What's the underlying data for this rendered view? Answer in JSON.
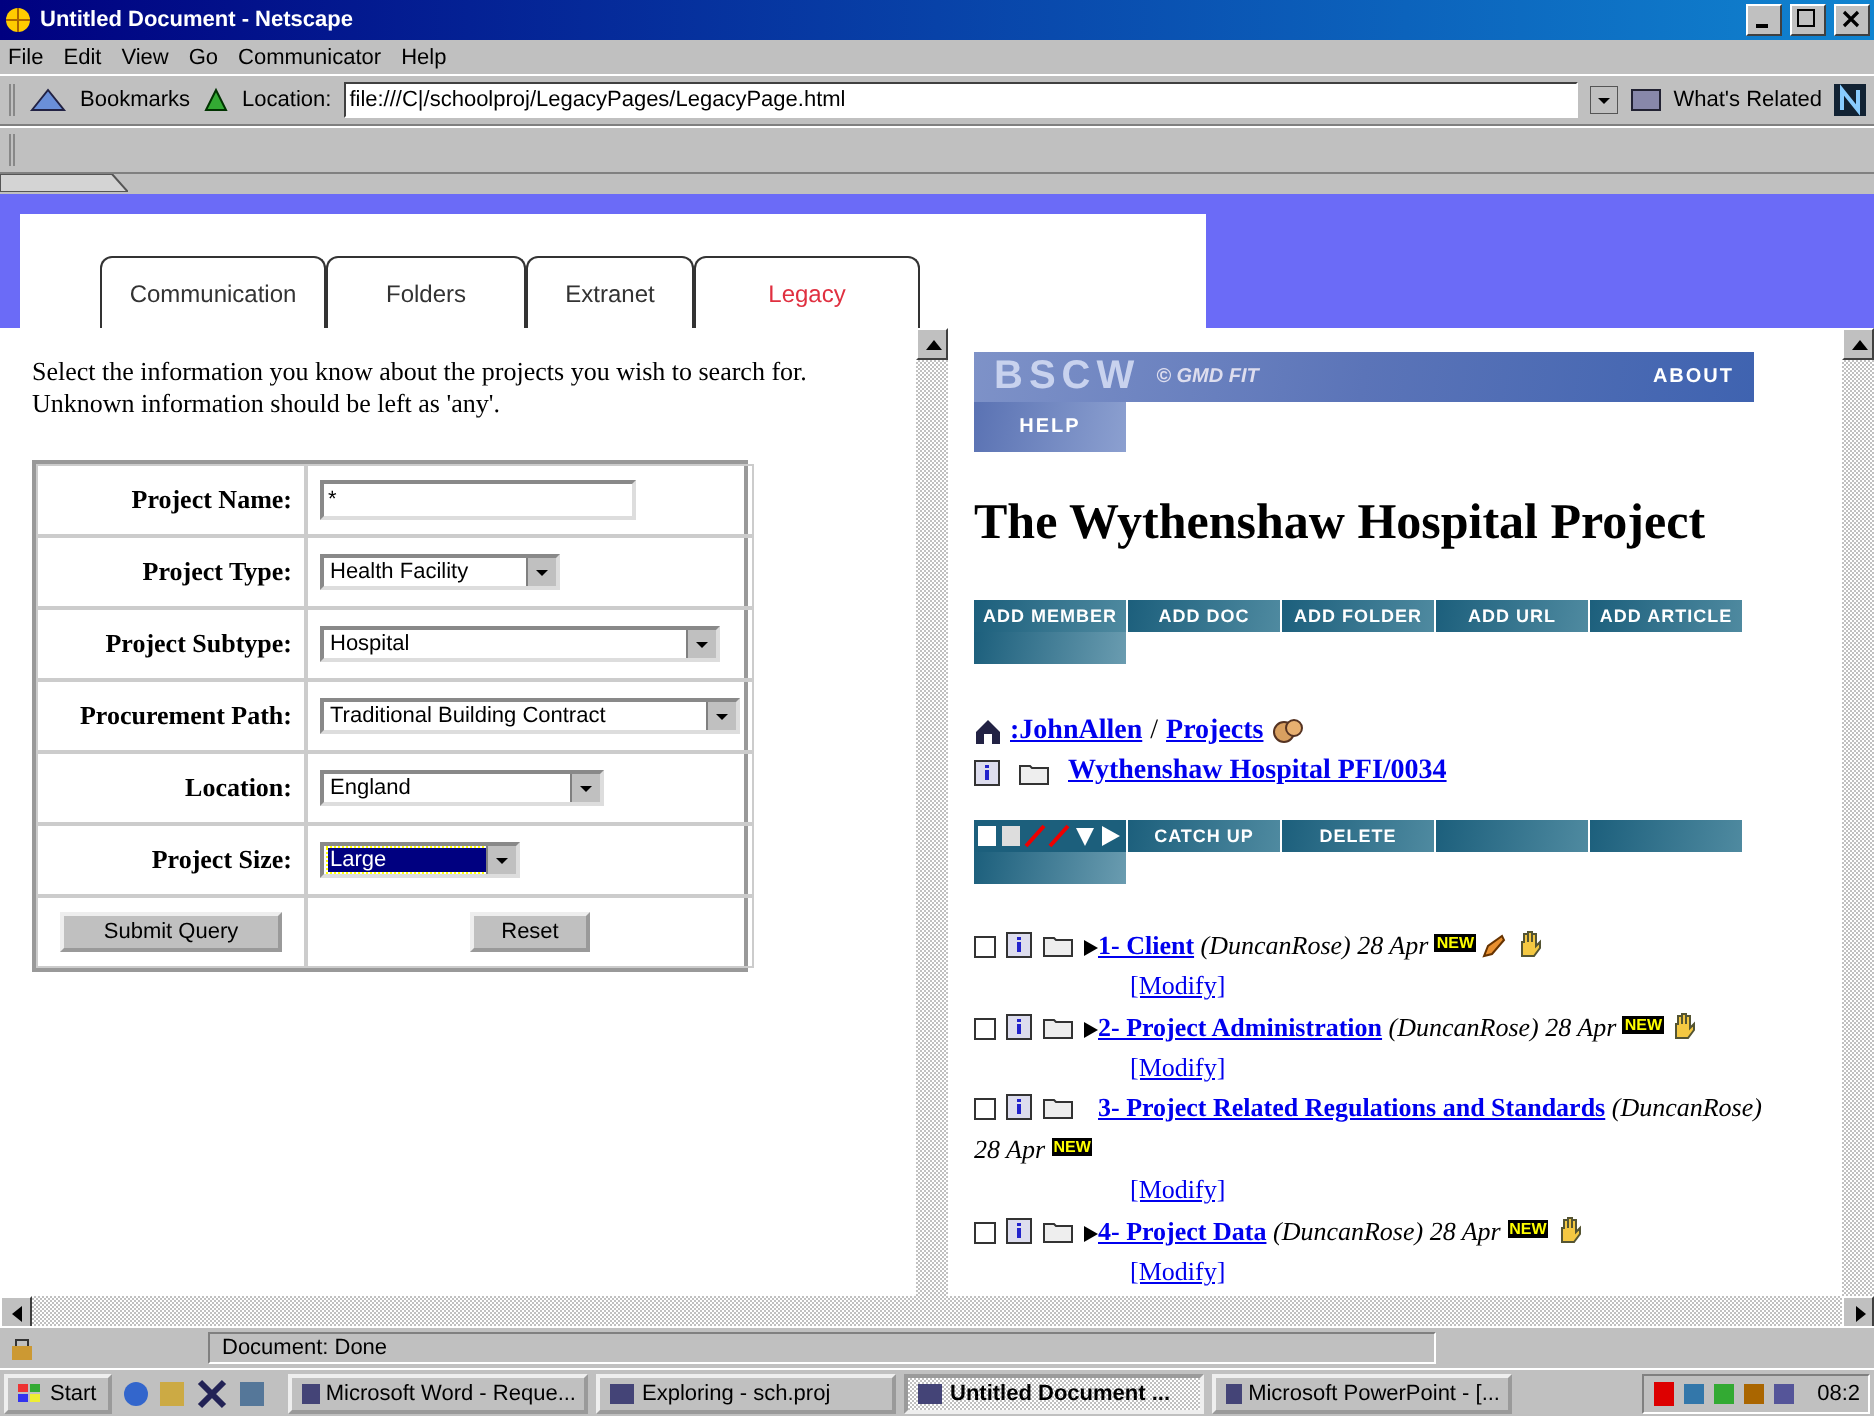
{
  "window": {
    "title": "Untitled Document - Netscape"
  },
  "menu": [
    "File",
    "Edit",
    "View",
    "Go",
    "Communicator",
    "Help"
  ],
  "location_bar": {
    "bookmarks": "Bookmarks",
    "location_label": "Location:",
    "url": "file:///C|/schoolproj/LegacyPages/LegacyPage.html",
    "related": "What's Related"
  },
  "tabs": [
    {
      "label": "Communication",
      "selected": false
    },
    {
      "label": "Folders",
      "selected": false
    },
    {
      "label": "Extranet",
      "selected": false
    },
    {
      "label": "Legacy",
      "selected": true
    }
  ],
  "search_form": {
    "intro": "Select the information you know about the projects you wish to search for. Unknown information should be left as 'any'.",
    "fields": [
      {
        "label": "Project Name:",
        "kind": "text",
        "value": "*",
        "focused": false
      },
      {
        "label": "Project Type:",
        "kind": "select",
        "value": "Health Facility",
        "focused": false
      },
      {
        "label": "Project Subtype:",
        "kind": "select",
        "value": "Hospital",
        "focused": false
      },
      {
        "label": "Procurement Path:",
        "kind": "select",
        "value": "Traditional Building Contract",
        "focused": false
      },
      {
        "label": "Location:",
        "kind": "select",
        "value": "England",
        "focused": false
      },
      {
        "label": "Project Size:",
        "kind": "select",
        "value": "Large",
        "focused": true
      }
    ],
    "buttons": [
      "Submit Query",
      "Reset"
    ]
  },
  "bscw": {
    "banner": {
      "logo": "BSCW",
      "credit": "© GMD FIT",
      "about": "ABOUT",
      "help": "HELP"
    },
    "heading": "The Wythenshaw Hospital Project",
    "toolbar": [
      "ADD MEMBER",
      "ADD DOC",
      "ADD FOLDER",
      "ADD URL",
      "ADD ARTICLE"
    ],
    "breadcrumb": {
      "user": ":JohnAllen",
      "separator": "/",
      "projects": "Projects"
    },
    "folder": "Wythenshaw Hospital PFI/0034",
    "actions": [
      "CATCH UP",
      "DELETE"
    ],
    "items": [
      {
        "title": "1- Client",
        "author": "(DuncanRose)",
        "date": "28 Apr",
        "badge": "NEW",
        "action": "[Modify]",
        "checked": false,
        "expandable": true,
        "edited": true,
        "locked": true
      },
      {
        "title": "2- Project Administration",
        "author": "(DuncanRose)",
        "date": "28 Apr",
        "badge": "NEW",
        "action": "[Modify]",
        "checked": false,
        "expandable": true,
        "edited": false,
        "locked": true
      },
      {
        "title": "3- Project Related Regulations and Standards",
        "author": "(DuncanRose)",
        "date": "28 Apr",
        "badge": "NEW",
        "action": "[Modify]",
        "checked": false,
        "expandable": false,
        "edited": false,
        "locked": false
      },
      {
        "title": "4- Project Data",
        "author": "(DuncanRose)",
        "date": "28 Apr",
        "badge": "NEW",
        "action": "[Modify]",
        "checked": false,
        "expandable": true,
        "edited": false,
        "locked": true
      }
    ]
  },
  "status_bar": {
    "text": "Document: Done"
  },
  "taskbar": {
    "start": "Start",
    "tasks": [
      {
        "label": "Microsoft Word - Reque...",
        "selected": false
      },
      {
        "label": "Exploring - sch.proj",
        "selected": false
      },
      {
        "label": "Untitled Document ...",
        "selected": true
      },
      {
        "label": "Microsoft PowerPoint - [...",
        "selected": false
      }
    ],
    "clock": "08:2"
  }
}
